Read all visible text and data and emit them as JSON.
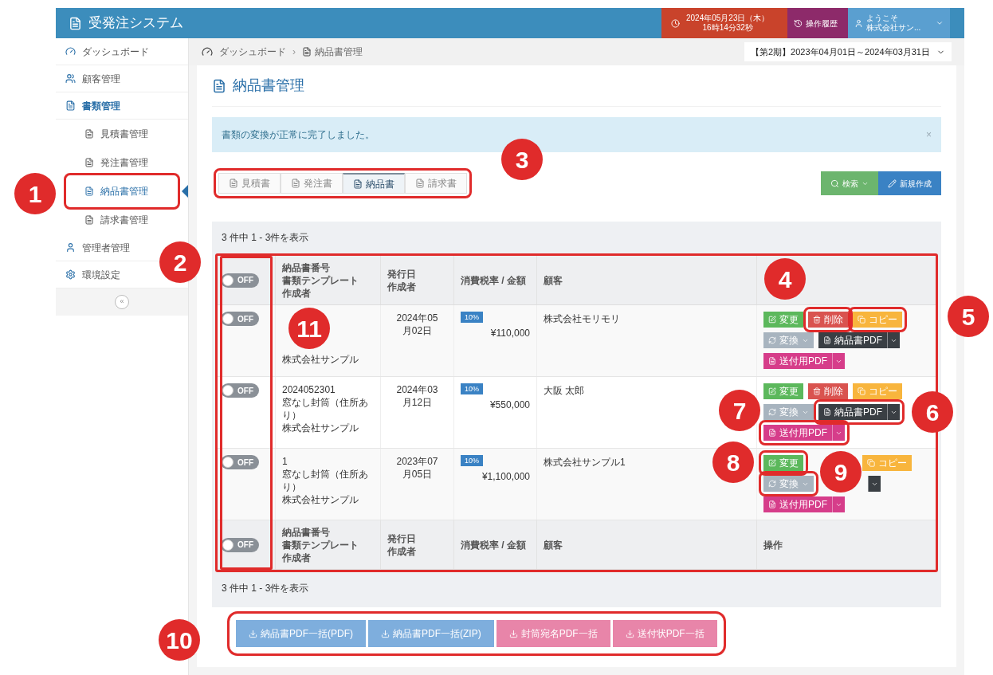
{
  "header": {
    "title": "受発注システム",
    "clock_date": "2024年05月23日（木）",
    "clock_time": "16時14分32秒",
    "history": "操作履歴",
    "welcome": "ようこそ",
    "user": "株式会社サン..."
  },
  "sidebar": {
    "items": [
      {
        "label": "ダッシュボード",
        "selected": false
      },
      {
        "label": "顧客管理",
        "selected": false
      },
      {
        "label": "書類管理",
        "selected": false,
        "expanded": true,
        "children": [
          {
            "label": "見積書管理",
            "selected": false,
            "highlighted": false
          },
          {
            "label": "発注書管理",
            "selected": false,
            "highlighted": false
          },
          {
            "label": "納品書管理",
            "selected": true,
            "highlighted": true
          },
          {
            "label": "請求書管理",
            "selected": false,
            "highlighted": false
          }
        ]
      },
      {
        "label": "管理者管理",
        "selected": false
      },
      {
        "label": "環境設定",
        "selected": false
      }
    ],
    "collapse": "«"
  },
  "breadcrumb": [
    "ダッシュボード",
    "納品書管理"
  ],
  "breadcrumb_separator": "›",
  "period": "【第2期】2023年04月01日～2024年03月31日",
  "page_title": "納品書管理",
  "alert": {
    "text": "書類の変換が正常に完了しました。",
    "close": "×"
  },
  "tabs": {
    "highlighted": true,
    "items": [
      {
        "label": "見積書",
        "selected": false
      },
      {
        "label": "発注書",
        "selected": false
      },
      {
        "label": "納品書",
        "selected": true
      },
      {
        "label": "請求書",
        "selected": false
      }
    ]
  },
  "search_button": "検索",
  "new_button": "新規作成",
  "count_top": "3 件中 1 - 3件を表示",
  "table": {
    "highlighted": true,
    "toggles_highlighted": true,
    "header": {
      "toggle": {
        "label": "OFF",
        "on": false
      },
      "cells": [
        [
          "納品書番号",
          "書類テンプレート",
          "作成者"
        ],
        [
          "発行日",
          "作成者"
        ],
        [
          "消費税率 / 金額"
        ],
        [
          "顧客"
        ],
        []
      ]
    },
    "rows": [
      {
        "toggle": {
          "label": "OFF",
          "on": false
        },
        "doc": [
          "株式会社サンプル"
        ],
        "date": "2024年05月02日",
        "tax": "10%",
        "amount": "¥110,000",
        "customer": "株式会社モリモリ",
        "actions": [
          {
            "kind": "edit",
            "label": "変更",
            "highlighted": false
          },
          {
            "kind": "delete",
            "label": "削除",
            "highlighted": true
          },
          {
            "kind": "copy",
            "label": "コピー",
            "highlighted": true
          },
          {
            "kind": "convert",
            "label": "変換",
            "highlighted": false
          },
          {
            "kind": "pdf",
            "label": "納品書PDF",
            "highlighted": false
          },
          {
            "kind": "send",
            "label": "送付用PDF",
            "highlighted": false
          }
        ]
      },
      {
        "toggle": {
          "label": "OFF",
          "on": false
        },
        "doc": [
          "2024052301",
          "窓なし封筒（住所あり）",
          "株式会社サンプル"
        ],
        "date": "2024年03月12日",
        "tax": "10%",
        "amount": "¥550,000",
        "customer": "大阪 太郎",
        "actions": [
          {
            "kind": "edit",
            "label": "変更",
            "highlighted": false
          },
          {
            "kind": "delete",
            "label": "削除",
            "highlighted": false
          },
          {
            "kind": "copy",
            "label": "コピー",
            "highlighted": false
          },
          {
            "kind": "convert",
            "label": "変換",
            "highlighted": false
          },
          {
            "kind": "pdf",
            "label": "納品書PDF",
            "highlighted": true
          },
          {
            "kind": "send",
            "label": "送付用PDF",
            "highlighted": true
          }
        ]
      },
      {
        "toggle": {
          "label": "OFF",
          "on": false
        },
        "doc": [
          "1",
          "窓なし封筒（住所あり）",
          "株式会社サンプル"
        ],
        "date": "2023年07月05日",
        "tax": "10%",
        "amount": "¥1,100,000",
        "customer": "株式会社サンプル1",
        "actions": [
          {
            "kind": "edit",
            "label": "変更",
            "highlighted": true
          },
          {
            "kind": "delete",
            "highlighted": false
          },
          {
            "kind": "copy",
            "label": "コピー",
            "highlighted": false
          },
          {
            "kind": "convert",
            "label": "変換",
            "highlighted": true
          },
          {
            "kind": "pdf",
            "highlighted": false
          },
          {
            "kind": "send",
            "label": "送付用PDF",
            "highlighted": false
          }
        ]
      }
    ],
    "footer": {
      "toggle": {
        "label": "OFF",
        "on": false
      },
      "cells": [
        [
          "納品書番号",
          "書類テンプレート",
          "作成者"
        ],
        [
          "発行日",
          "作成者"
        ],
        [
          "消費税率 / 金額"
        ],
        [
          "顧客"
        ],
        [
          "操作"
        ]
      ]
    }
  },
  "count_bottom": "3 件中 1 - 3件を表示",
  "bulk": {
    "highlighted": true,
    "buttons": [
      {
        "label": "納品書PDF一括(PDF)",
        "color": "#7eaedd"
      },
      {
        "label": "納品書PDF一括(ZIP)",
        "color": "#7eaedd"
      },
      {
        "label": "封筒宛名PDF一括",
        "color": "#e885a9"
      },
      {
        "label": "送付状PDF一括",
        "color": "#e885a9"
      }
    ]
  },
  "callouts": [
    {
      "label": "1"
    },
    {
      "label": "2"
    },
    {
      "label": "3"
    },
    {
      "label": "4"
    },
    {
      "label": "5"
    },
    {
      "label": "6"
    },
    {
      "label": "7"
    },
    {
      "label": "8"
    },
    {
      "label": "9"
    },
    {
      "label": "10"
    },
    {
      "label": "11"
    }
  ]
}
